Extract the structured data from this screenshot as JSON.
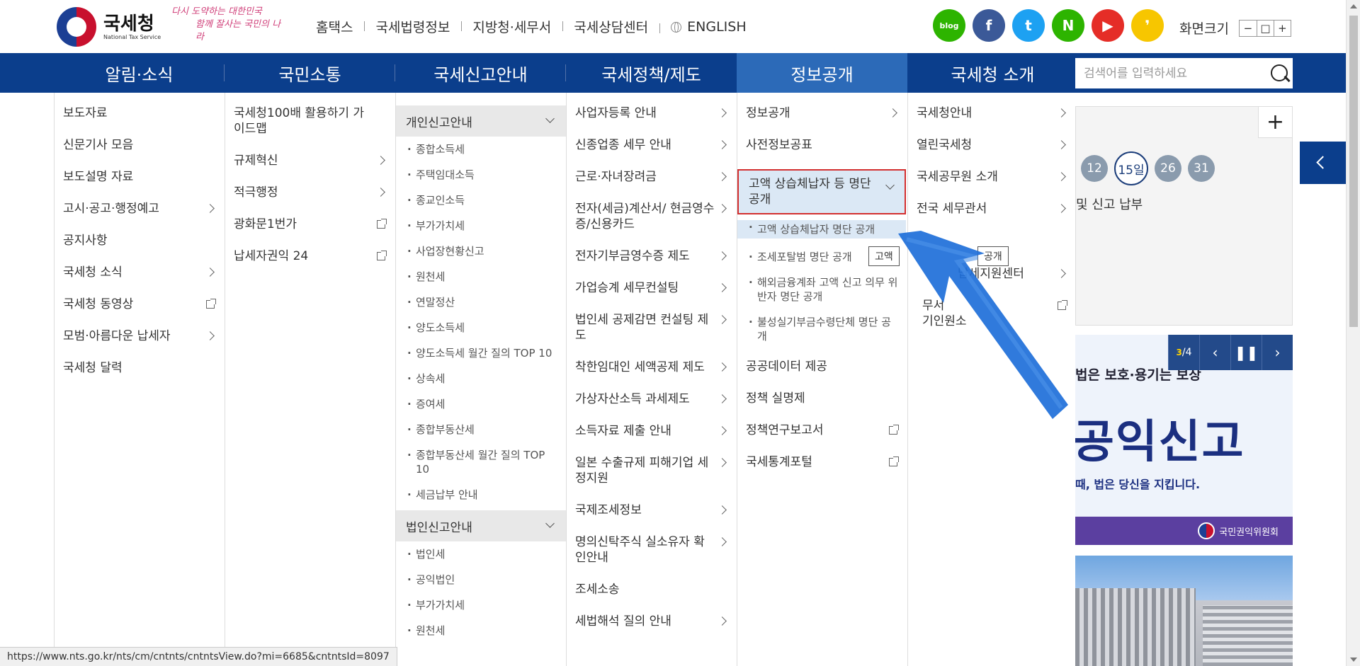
{
  "header": {
    "logo_title": "국세청",
    "logo_sub": "National Tax Service",
    "slogan_line1": "다시 도약하는 대한민국",
    "slogan_line2": "함께 잘사는 국민의 나라",
    "links": [
      "홈택스",
      "국세법령정보",
      "지방청·세무서",
      "국세상담센터"
    ],
    "english": "ENGLISH",
    "sns": [
      {
        "name": "blog",
        "label": "blog",
        "color": "#2db400"
      },
      {
        "name": "facebook",
        "label": "f",
        "color": "#3b5998"
      },
      {
        "name": "twitter",
        "label": "t",
        "color": "#1da1f2"
      },
      {
        "name": "naver-post",
        "label": "N",
        "color": "#2db400"
      },
      {
        "name": "youtube",
        "label": "▶",
        "color": "#e52d27"
      },
      {
        "name": "kakao",
        "label": "❜",
        "color": "#f7c600"
      }
    ],
    "screen_size_label": "화면크기",
    "zoom_minus": "−",
    "zoom_reset": "□",
    "zoom_plus": "+"
  },
  "nav": {
    "items": [
      "알림·소식",
      "국민소통",
      "국세신고안내",
      "국세정책/제도",
      "정보공개",
      "국세청 소개"
    ],
    "active_index": 4,
    "search_placeholder": "검색어를 입력하세요"
  },
  "mega": {
    "col1": [
      {
        "label": "보도자료",
        "type": "plain"
      },
      {
        "label": "신문기사 모음",
        "type": "plain"
      },
      {
        "label": "보도설명 자료",
        "type": "plain"
      },
      {
        "label": "고시·공고·행정예고",
        "type": "arrow"
      },
      {
        "label": "공지사항",
        "type": "plain"
      },
      {
        "label": "국세청 소식",
        "type": "arrow"
      },
      {
        "label": "국세청 동영상",
        "type": "ext"
      },
      {
        "label": "모범·아름다운 납세자",
        "type": "arrow"
      },
      {
        "label": "국세청 달력",
        "type": "plain"
      }
    ],
    "col2": [
      {
        "label": "국세청100배 활용하기 가이드맵",
        "type": "plain"
      },
      {
        "label": "규제혁신",
        "type": "arrow"
      },
      {
        "label": "적극행정",
        "type": "arrow"
      },
      {
        "label": "광화문1번가",
        "type": "ext"
      },
      {
        "label": "납세자권익 24",
        "type": "ext"
      }
    ],
    "col3_group1": "개인신고안내",
    "col3_group1_items": [
      "종합소득세",
      "주택임대소득",
      "종교인소득",
      "부가가치세",
      "사업장현황신고",
      "원천세",
      "연말정산",
      "양도소득세",
      "양도소득세 월간 질의 TOP 10",
      "상속세",
      "증여세",
      "종합부동산세",
      "종합부동산세 월간 질의 TOP 10",
      "세금납부 안내"
    ],
    "col3_group2": "법인신고안내",
    "col3_group2_items": [
      "법인세",
      "공익법인",
      "부가가치세",
      "원천세"
    ],
    "col4": [
      {
        "label": "사업자등록 안내",
        "type": "arrow"
      },
      {
        "label": "신종업종 세무 안내",
        "type": "arrow"
      },
      {
        "label": "근로·자녀장려금",
        "type": "arrow"
      },
      {
        "label": "전자(세금)계산서/ 현금영수증/신용카드",
        "type": "arrow"
      },
      {
        "label": "전자기부금영수증 제도",
        "type": "arrow"
      },
      {
        "label": "가업승계 세무컨설팅",
        "type": "arrow"
      },
      {
        "label": "법인세 공제감면 컨설팅 제도",
        "type": "arrow"
      },
      {
        "label": "착한임대인 세액공제 제도",
        "type": "arrow"
      },
      {
        "label": "가상자산소득 과세제도",
        "type": "arrow"
      },
      {
        "label": "소득자료 제출 안내",
        "type": "arrow"
      },
      {
        "label": "일본 수출규제 피해기업 세정지원",
        "type": "arrow"
      },
      {
        "label": "국제조세정보",
        "type": "arrow"
      },
      {
        "label": "명의신탁주식 실소유자 확인안내",
        "type": "arrow"
      },
      {
        "label": "조세소송",
        "type": "plain"
      },
      {
        "label": "세법해석 질의 안내",
        "type": "arrow"
      }
    ],
    "col5_top": [
      {
        "label": "정보공개",
        "type": "arrow"
      },
      {
        "label": "사전정보공표",
        "type": "plain"
      }
    ],
    "col5_highlight": "고액 상습체납자 등 명단 공개",
    "col5_subs": [
      "고액 상습체납자 명단 공개",
      "조세포탈범 명단 공개",
      "해외금융계좌 고액 신고 의무 위반자 명단 공개",
      "불성실기부금수령단체 명단 공개"
    ],
    "col5_bottom": [
      {
        "label": "공공데이터 제공",
        "type": "plain"
      },
      {
        "label": "정책 실명제",
        "type": "plain"
      },
      {
        "label": "정책연구보고서",
        "type": "ext"
      },
      {
        "label": "국세통계포털",
        "type": "ext"
      }
    ],
    "col6": [
      {
        "label": "국세청안내",
        "type": "arrow"
      },
      {
        "label": "열린국세청",
        "type": "arrow"
      },
      {
        "label": "국세공무원 소개",
        "type": "arrow"
      },
      {
        "label": "전국 세무관서",
        "type": "arrow"
      }
    ],
    "col6_partial": [
      "납세지원센터",
      "무서",
      "기인원소"
    ],
    "tooltip_left": "고액",
    "tooltip_right": "공개"
  },
  "side": {
    "days": [
      "12",
      "15일",
      "26",
      "31"
    ],
    "active_day": 1,
    "tax_note": "및 신고 납부",
    "banner_counter_cur": "3",
    "banner_counter_total": "4",
    "banner_head": "법은 보호·용기는 보상",
    "banner_big": "공익신고",
    "banner_small": "때, 법은 당신을 지킵니다.",
    "banner_footer": "국민권익위원회"
  },
  "status_url": "https://www.nts.go.kr/nts/cm/cntnts/cntntsView.do?mi=6685&cntntsId=8097"
}
